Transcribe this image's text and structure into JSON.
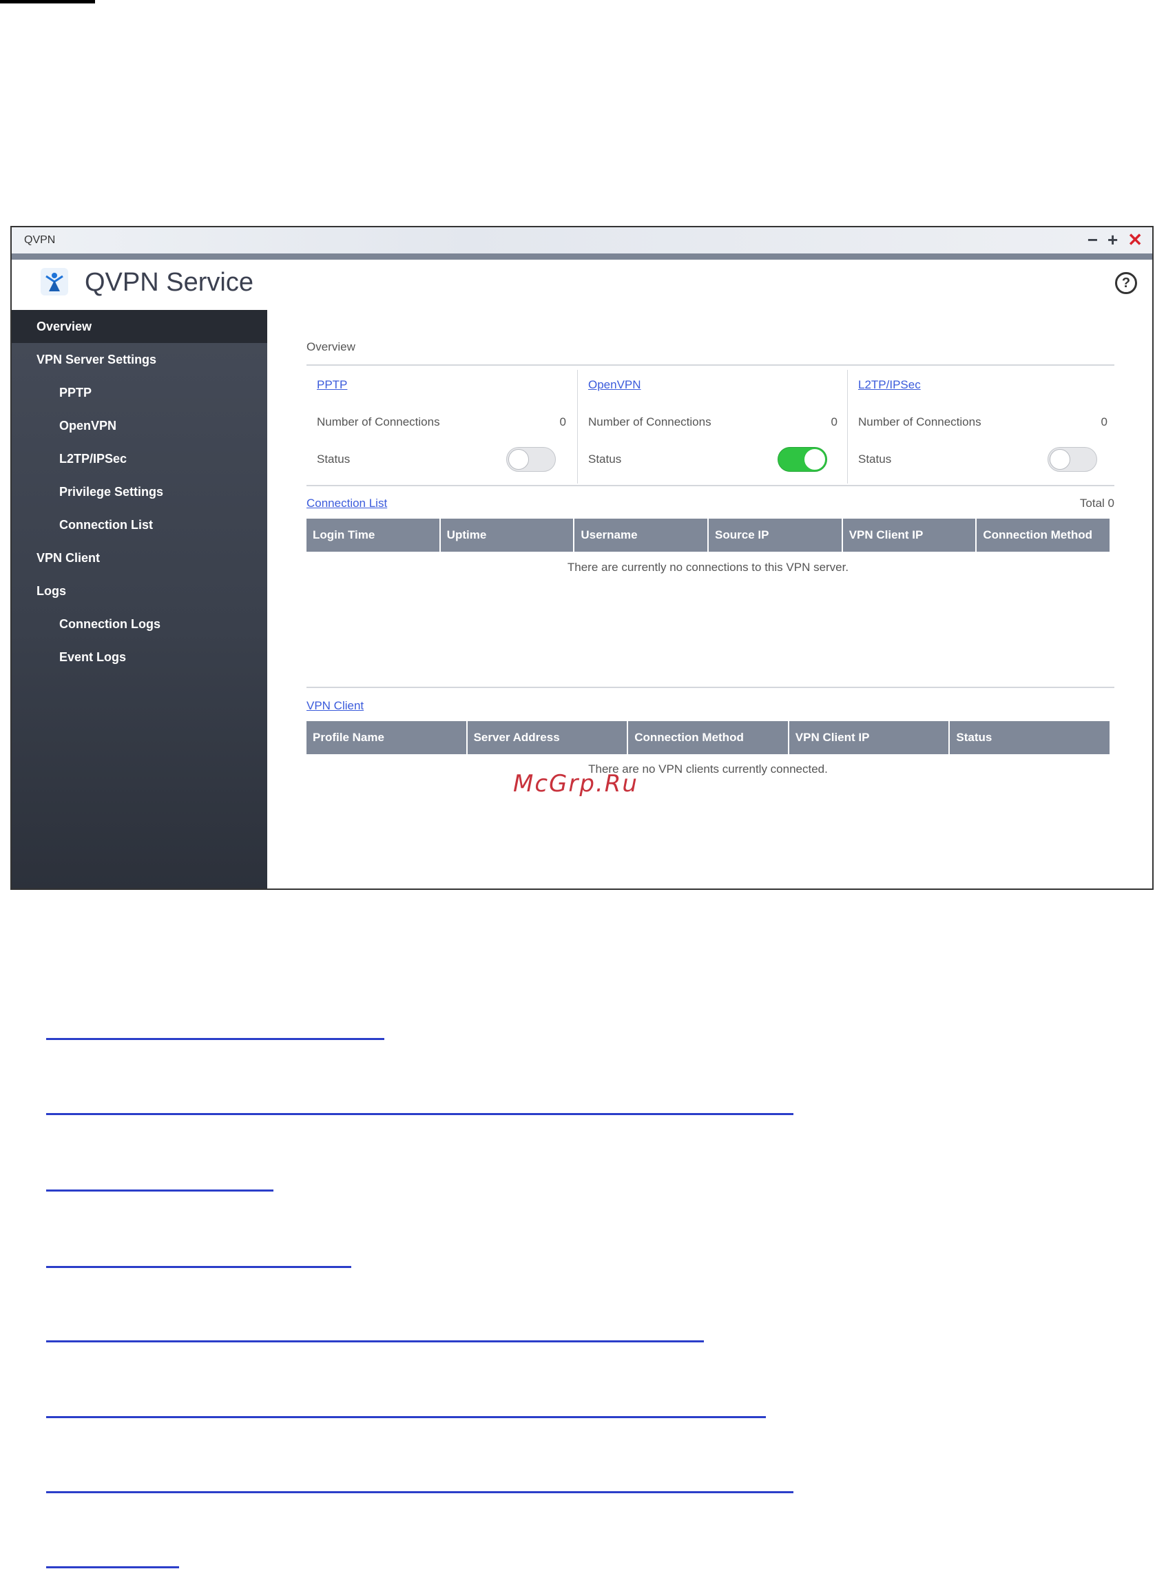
{
  "window": {
    "title": "QVPN",
    "controls": {
      "minimize": "−",
      "maximize": "+",
      "close": "✕"
    }
  },
  "app": {
    "title": "QVPN Service",
    "help": "?"
  },
  "sidebar": {
    "items": [
      {
        "label": "Overview",
        "active": true,
        "level": 0
      },
      {
        "label": "VPN Server Settings",
        "level": 0
      },
      {
        "label": "PPTP",
        "level": 1
      },
      {
        "label": "OpenVPN",
        "level": 1
      },
      {
        "label": "L2TP/IPSec",
        "level": 1
      },
      {
        "label": "Privilege Settings",
        "level": 1
      },
      {
        "label": "Connection List",
        "level": 1
      },
      {
        "label": "VPN Client",
        "level": 0
      },
      {
        "label": "Logs",
        "level": 0
      },
      {
        "label": "Connection Logs",
        "level": 1
      },
      {
        "label": "Event Logs",
        "level": 1
      }
    ]
  },
  "overview": {
    "label": "Overview",
    "protocols": [
      {
        "name": "PPTP",
        "connections_label": "Number of Connections",
        "connections": "0",
        "status_label": "Status",
        "enabled": false
      },
      {
        "name": "OpenVPN",
        "connections_label": "Number of Connections",
        "connections": "0",
        "status_label": "Status",
        "enabled": true
      },
      {
        "name": "L2TP/IPSec",
        "connections_label": "Number of Connections",
        "connections": "0",
        "status_label": "Status",
        "enabled": false
      }
    ]
  },
  "connection_list": {
    "label": "Connection List",
    "total": "Total 0",
    "columns": [
      "Login Time",
      "Uptime",
      "Username",
      "Source IP",
      "VPN Client IP",
      "Connection Method"
    ],
    "empty": "There are currently no connections to this VPN server."
  },
  "vpn_client": {
    "label": "VPN Client",
    "columns": [
      "Profile Name",
      "Server Address",
      "Connection Method",
      "VPN Client IP",
      "Status"
    ],
    "empty": "There are no VPN clients currently connected."
  },
  "watermark": "McGrp.Ru",
  "colors": {
    "sidebar_bg": "#3a404c",
    "sidebar_active": "#272b33",
    "table_header": "#7f8898",
    "link": "#3b5bdb",
    "toggle_on": "#2fc442",
    "close_red": "#d9212b",
    "watermark": "#c8323c"
  }
}
